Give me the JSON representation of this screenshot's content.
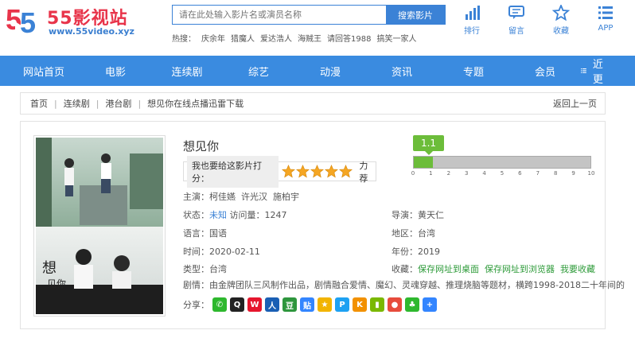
{
  "logo": {
    "title": "55影视站",
    "url": "www.55video.xyz"
  },
  "search": {
    "placeholder": "请在此处输入影片名或演员名称",
    "button": "搜索影片"
  },
  "hot": {
    "label": "热搜：",
    "items": [
      "庆余年",
      "猎魔人",
      "爱达浩人",
      "海贼王",
      "请回答1988",
      "搞笑一家人"
    ]
  },
  "tools": [
    {
      "label": "排行",
      "icon": "ranking-icon"
    },
    {
      "label": "留言",
      "icon": "message-icon"
    },
    {
      "label": "收藏",
      "icon": "star-icon"
    },
    {
      "label": "APP",
      "icon": "menu-icon"
    }
  ],
  "nav": {
    "items": [
      "网站首页",
      "电影",
      "连续剧",
      "综艺",
      "动漫",
      "资讯",
      "专题",
      "会员"
    ],
    "recent": "最近更新"
  },
  "breadcrumb": {
    "items": [
      "首页",
      "连续剧",
      "港台剧",
      "想见你在线点播迅雷下载"
    ],
    "back": "返回上一页"
  },
  "movie": {
    "title": "想见你",
    "rate_label": "我也要给这影片打分：",
    "rate_level": "力荐",
    "stars_filled": 5,
    "score": "1.1",
    "score_value": 1.1,
    "score_max": 10,
    "score_ticks": [
      "0",
      "1",
      "2",
      "3",
      "4",
      "5",
      "6",
      "7",
      "8",
      "9",
      "10"
    ],
    "cast_label": "主演：",
    "cast": [
      "柯佳嬿",
      "许光汉",
      "施柏宇"
    ],
    "status_label": "状态：",
    "status": "未知",
    "views_label": "访问量：",
    "views": "1247",
    "director_label": "导演：",
    "director": "黄天仁",
    "language_label": "语言：",
    "language": "国语",
    "region_label": "地区：",
    "region": "台湾",
    "time_label": "时间：",
    "time": "2020-02-11",
    "year_label": "年份：",
    "year": "2019",
    "type_label": "类型：",
    "type": "台湾",
    "fav_label": "收藏：",
    "fav_links": [
      "保存网址到桌面",
      "保存网址到浏览器",
      "我要收藏"
    ],
    "plot_label": "剧情：",
    "plot": "由金牌团队三风制作出品，剧情融合爱情、魔幻、灵魂穿越、推理烧脑等题材，横跨1998-2018二十年间的",
    "share_label": "分享："
  },
  "share_icons": [
    {
      "name": "wechat-icon",
      "color": "#2eb82e",
      "glyph": "✆"
    },
    {
      "name": "qq-icon",
      "color": "#222",
      "glyph": "Q"
    },
    {
      "name": "weibo-icon",
      "color": "#e6162d",
      "glyph": "W"
    },
    {
      "name": "renren-icon",
      "color": "#1a5fb4",
      "glyph": "人"
    },
    {
      "name": "douban-icon",
      "color": "#2e963d",
      "glyph": "豆"
    },
    {
      "name": "tieba-icon",
      "color": "#3385ff",
      "glyph": "贴"
    },
    {
      "name": "qzone-icon",
      "color": "#f2b400",
      "glyph": "★"
    },
    {
      "name": "pengyou-icon",
      "color": "#1da1f2",
      "glyph": "P"
    },
    {
      "name": "kaixin-icon",
      "color": "#f29100",
      "glyph": "K"
    },
    {
      "name": "pinterest-icon",
      "color": "#7ab800",
      "glyph": "▮"
    },
    {
      "name": "youdao-icon",
      "color": "#e74c3c",
      "glyph": "●"
    },
    {
      "name": "clover-icon",
      "color": "#2eb82e",
      "glyph": "♣"
    },
    {
      "name": "more-icon",
      "color": "#3385ff",
      "glyph": "+"
    }
  ]
}
